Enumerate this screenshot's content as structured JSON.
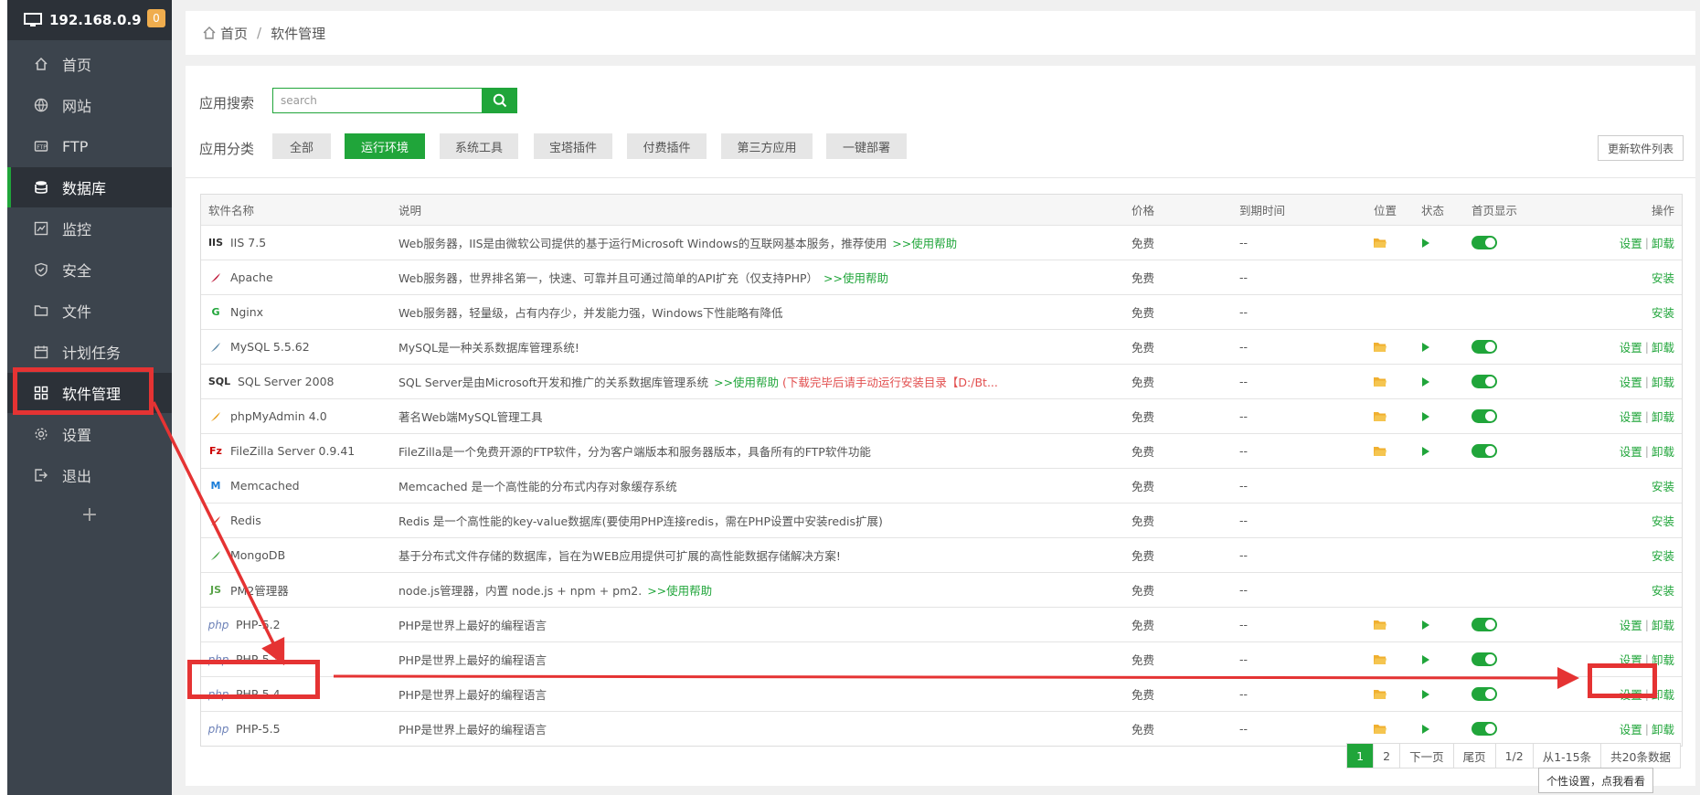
{
  "server": {
    "ip": "192.168.0.9",
    "badge": "0"
  },
  "sidebar": {
    "items": [
      {
        "label": "首页"
      },
      {
        "label": "网站"
      },
      {
        "label": "FTP"
      },
      {
        "label": "数据库"
      },
      {
        "label": "监控"
      },
      {
        "label": "安全"
      },
      {
        "label": "文件"
      },
      {
        "label": "计划任务"
      },
      {
        "label": "软件管理"
      },
      {
        "label": "设置"
      },
      {
        "label": "退出"
      }
    ],
    "add": "+"
  },
  "breadcrumb": {
    "home": "首页",
    "sep": "/",
    "current": "软件管理"
  },
  "search": {
    "label": "应用搜索",
    "placeholder": "search"
  },
  "categories": {
    "label": "应用分类",
    "items": [
      "全部",
      "运行环境",
      "系统工具",
      "宝塔插件",
      "付费插件",
      "第三方应用",
      "一键部署"
    ],
    "update": "更新软件列表"
  },
  "table": {
    "headers": [
      "软件名称",
      "说明",
      "价格",
      "到期时间",
      "位置",
      "状态",
      "首页显示",
      "操作"
    ],
    "rows": [
      {
        "name": "IIS 7.5",
        "icon": "IIS",
        "desc": "Web服务器，IIS是由微软公司提供的基于运行Microsoft Windows的互联网基本服务，推荐使用",
        "link": ">>使用帮助",
        "price": "免费",
        "expire": "--",
        "installed": true
      },
      {
        "name": "Apache",
        "icon": "apache-icon",
        "desc": "Web服务器，世界排名第一，快速、可靠并且可通过简单的API扩充（仅支持PHP）",
        "link": ">>使用帮助",
        "price": "免费",
        "expire": "--",
        "installed": false
      },
      {
        "name": "Nginx",
        "icon": "G",
        "desc": "Web服务器，轻量级，占有内存少，并发能力强，Windows下性能略有降低",
        "link": "",
        "price": "免费",
        "expire": "--",
        "installed": false
      },
      {
        "name": "MySQL 5.5.62",
        "icon": "mysql-icon",
        "desc": "MySQL是一种关系数据库管理系统!",
        "link": "",
        "price": "免费",
        "expire": "--",
        "installed": true
      },
      {
        "name": "SQL Server 2008",
        "icon": "SQL",
        "desc": "SQL Server是由Microsoft开发和推广的关系数据库管理系统",
        "link": ">>使用帮助",
        "warn": "(下载完毕后请手动运行安装目录【D:/Bt...",
        "price": "免费",
        "expire": "--",
        "installed": true
      },
      {
        "name": "phpMyAdmin 4.0",
        "icon": "pma-icon",
        "desc": "著名Web端MySQL管理工具",
        "link": "",
        "price": "免费",
        "expire": "--",
        "installed": true
      },
      {
        "name": "FileZilla Server 0.9.41",
        "icon": "Fz",
        "desc": "FileZilla是一个免费开源的FTP软件，分为客户端版本和服务器版本，具备所有的FTP软件功能",
        "link": "",
        "price": "免费",
        "expire": "--",
        "installed": true
      },
      {
        "name": "Memcached",
        "icon": "M",
        "desc": "Memcached 是一个高性能的分布式内存对象缓存系统",
        "link": "",
        "price": "免费",
        "expire": "--",
        "installed": false
      },
      {
        "name": "Redis",
        "icon": "redis-icon",
        "desc": "Redis 是一个高性能的key-value数据库(要使用PHP连接redis，需在PHP设置中安装redis扩展)",
        "link": "",
        "price": "免费",
        "expire": "--",
        "installed": false
      },
      {
        "name": "MongoDB",
        "icon": "mongo-icon",
        "desc": "基于分布式文件存储的数据库，旨在为WEB应用提供可扩展的高性能数据存储解决方案!",
        "link": "",
        "price": "免费",
        "expire": "--",
        "installed": false
      },
      {
        "name": "PM2管理器",
        "icon": "JS",
        "desc": "node.js管理器，内置 node.js + npm + pm2.",
        "link": ">>使用帮助",
        "price": "免费",
        "expire": "--",
        "installed": false
      },
      {
        "name": "PHP-5.2",
        "icon": "php",
        "desc": "PHP是世界上最好的编程语言",
        "link": "",
        "price": "免费",
        "expire": "--",
        "installed": true
      },
      {
        "name": "PHP-5.3",
        "icon": "php",
        "desc": "PHP是世界上最好的编程语言",
        "link": "",
        "price": "免费",
        "expire": "--",
        "installed": true
      },
      {
        "name": "PHP-5.4",
        "icon": "php",
        "desc": "PHP是世界上最好的编程语言",
        "link": "",
        "price": "免费",
        "expire": "--",
        "installed": true
      },
      {
        "name": "PHP-5.5",
        "icon": "php",
        "desc": "PHP是世界上最好的编程语言",
        "link": "",
        "price": "免费",
        "expire": "--",
        "installed": true
      }
    ],
    "ops": {
      "settings": "设置",
      "uninstall": "卸载",
      "install": "安装",
      "sep": "|"
    }
  },
  "pagination": [
    "1",
    "2",
    "下一页",
    "尾页",
    "1/2",
    "从1-15条",
    "共20条数据"
  ],
  "tooltip": "个性设置，点我看看",
  "colors": {
    "accent": "#20a53a",
    "annotation": "#e53333",
    "sidebar": "#3c444d"
  }
}
